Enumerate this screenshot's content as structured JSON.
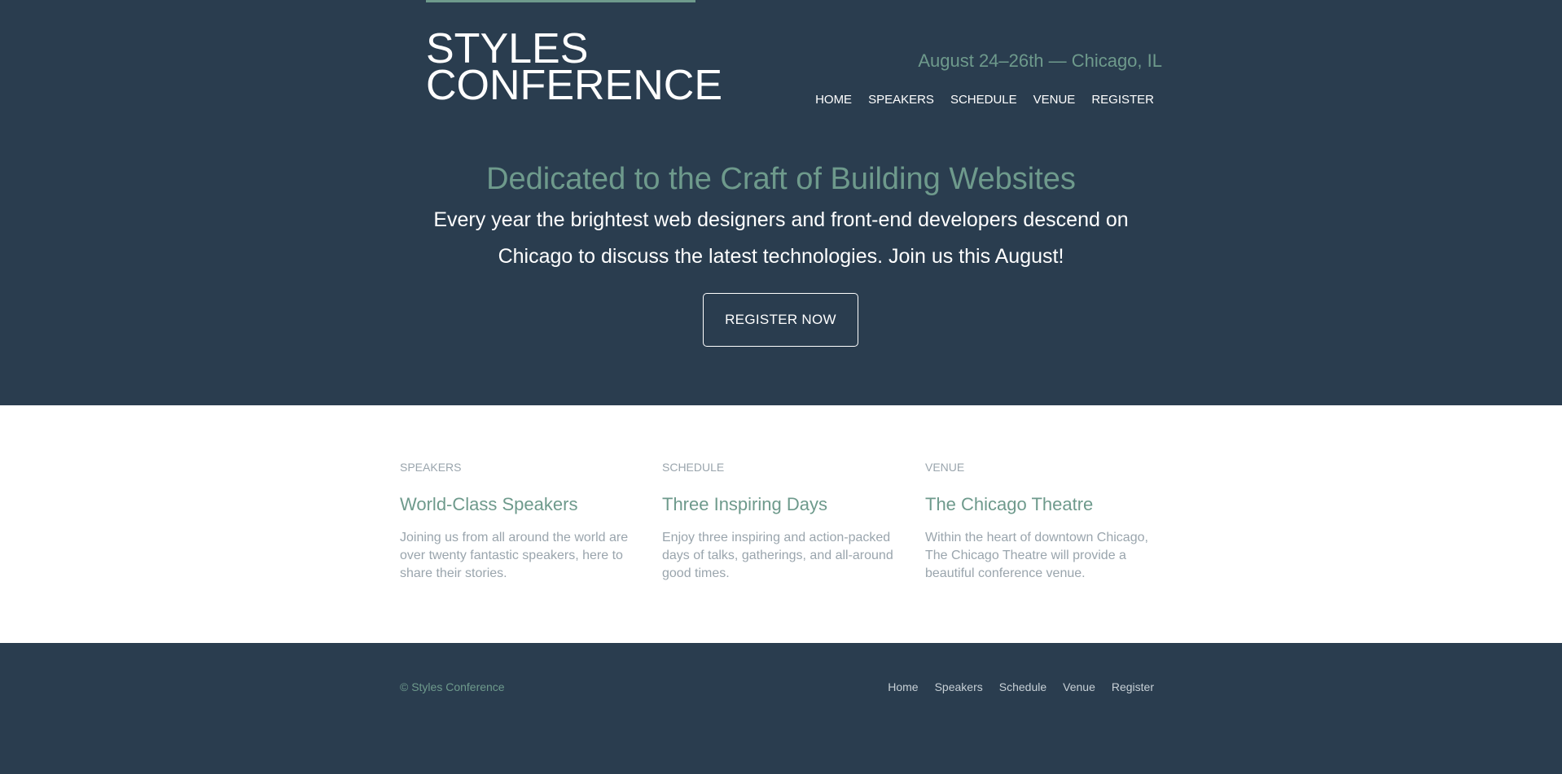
{
  "brand": {
    "logo_line1": "STYLES",
    "logo_line2": "CONFERENCE"
  },
  "header": {
    "dates": "August 24–26th — Chicago, IL",
    "nav": [
      "HOME",
      "SPEAKERS",
      "SCHEDULE",
      "VENUE",
      "REGISTER"
    ]
  },
  "hero": {
    "title": "Dedicated to the Craft of Building Websites",
    "text_line1": "Every year the brightest web designers and front-end developers descend on",
    "text_line2": "Chicago to discuss the latest technologies. Join us this August!",
    "cta_label": "REGISTER NOW"
  },
  "features": [
    {
      "kicker": "SPEAKERS",
      "title": "World-Class Speakers",
      "description": "Joining us from all around the world are over twenty fantastic speakers, here to share their stories."
    },
    {
      "kicker": "SCHEDULE",
      "title": "Three Inspiring Days",
      "description": "Enjoy three inspiring and action-packed days of talks, gatherings, and all-around good times."
    },
    {
      "kicker": "VENUE",
      "title": "The Chicago Theatre",
      "description": "Within the heart of downtown Chicago, The Chicago Theatre will provide a beautiful conference venue."
    }
  ],
  "footer": {
    "copyright": "© Styles Conference",
    "nav": [
      "Home",
      "Speakers",
      "Schedule",
      "Venue",
      "Register"
    ]
  },
  "colors": {
    "background": "#2a3d4f",
    "accent": "#6e9a8c",
    "muted_text": "#9aa5ad",
    "surface": "#ffffff"
  }
}
